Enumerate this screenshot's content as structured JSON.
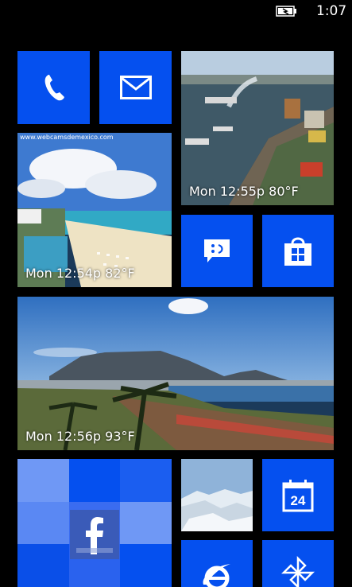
{
  "status_bar": {
    "time": "1:07",
    "battery_icon": "battery-charging-icon"
  },
  "colors": {
    "accent": "#0550ef",
    "background": "#000000"
  },
  "tiles": {
    "phone": {
      "icon": "phone-icon"
    },
    "mail": {
      "icon": "mail-icon"
    },
    "harbor_cam": {
      "caption": "Mon 12:55p 80°F"
    },
    "beach_cam": {
      "watermark": "www.webcamsdemexico.com",
      "caption": "Mon 12:54p 82°F"
    },
    "messaging": {
      "icon": "messaging-smiley-icon"
    },
    "store": {
      "icon": "store-bag-icon"
    },
    "table_mountain_cam": {
      "caption": "Mon 12:56p 93°F"
    },
    "facebook": {
      "icon": "facebook-icon"
    },
    "mountain_photo": {},
    "calendar": {
      "icon": "calendar-icon",
      "day": "24"
    },
    "internet_explorer": {
      "icon": "internet-explorer-icon"
    },
    "pinwheel": {
      "icon": "pinwheel-icon"
    }
  }
}
